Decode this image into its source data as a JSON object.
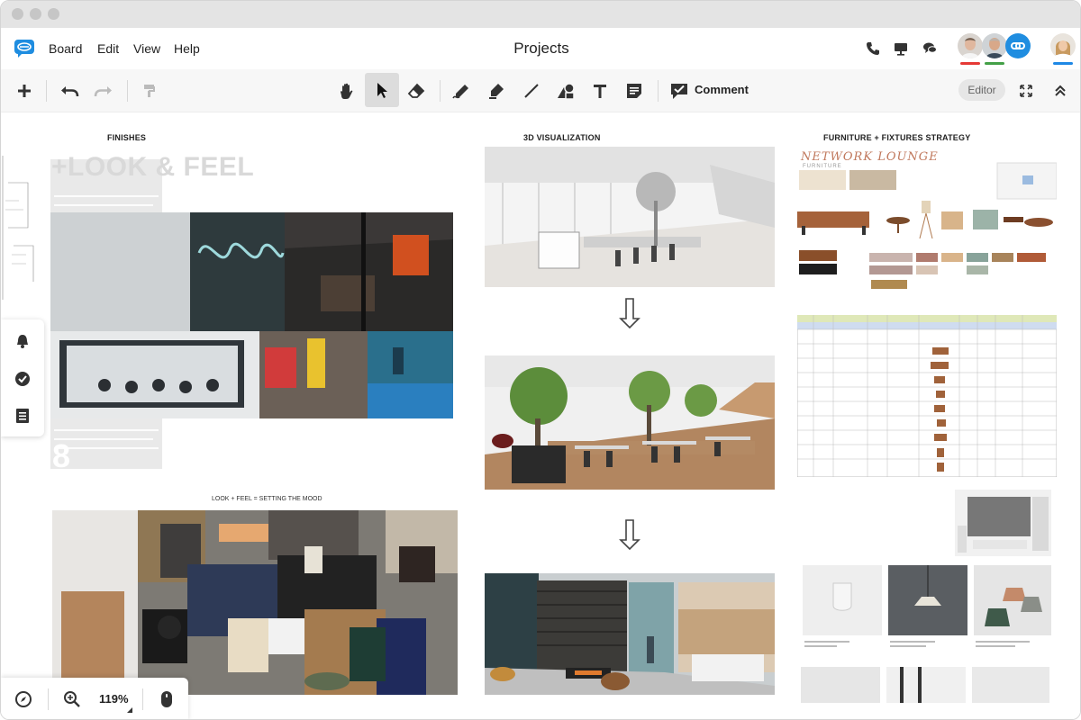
{
  "window": {
    "title": "Projects"
  },
  "menu": {
    "items": [
      "Board",
      "Edit",
      "View",
      "Help"
    ]
  },
  "header": {
    "icons": [
      "phone-icon",
      "present-icon",
      "chat-icon",
      "share-link-icon"
    ],
    "collaborator_bar_colors": [
      "#e53935",
      "#43a047",
      "#1e88e5"
    ]
  },
  "toolbar": {
    "comment_label": "Comment",
    "mode_label": "Editor",
    "tools": [
      "add",
      "undo",
      "redo",
      "format-painter",
      "hand",
      "select",
      "eraser",
      "pen",
      "highlighter",
      "line",
      "shapes",
      "text",
      "sticky-note",
      "comment"
    ]
  },
  "board": {
    "sections": {
      "finishes": "FINISHES",
      "visualization": "3D VISUALIZATION",
      "furniture": "FURNITURE + FIXTURES STRATEGY"
    },
    "look_feel_heading": "+LOOK & FEEL",
    "mood_caption": "LOOK + FEEL = SETTING THE MOOD",
    "lounge_title": "NETWORK LOUNGE",
    "lounge_subtitle": "FURNITURE",
    "accent_color": "#1f8de0"
  },
  "zoom": {
    "level": "119%"
  }
}
